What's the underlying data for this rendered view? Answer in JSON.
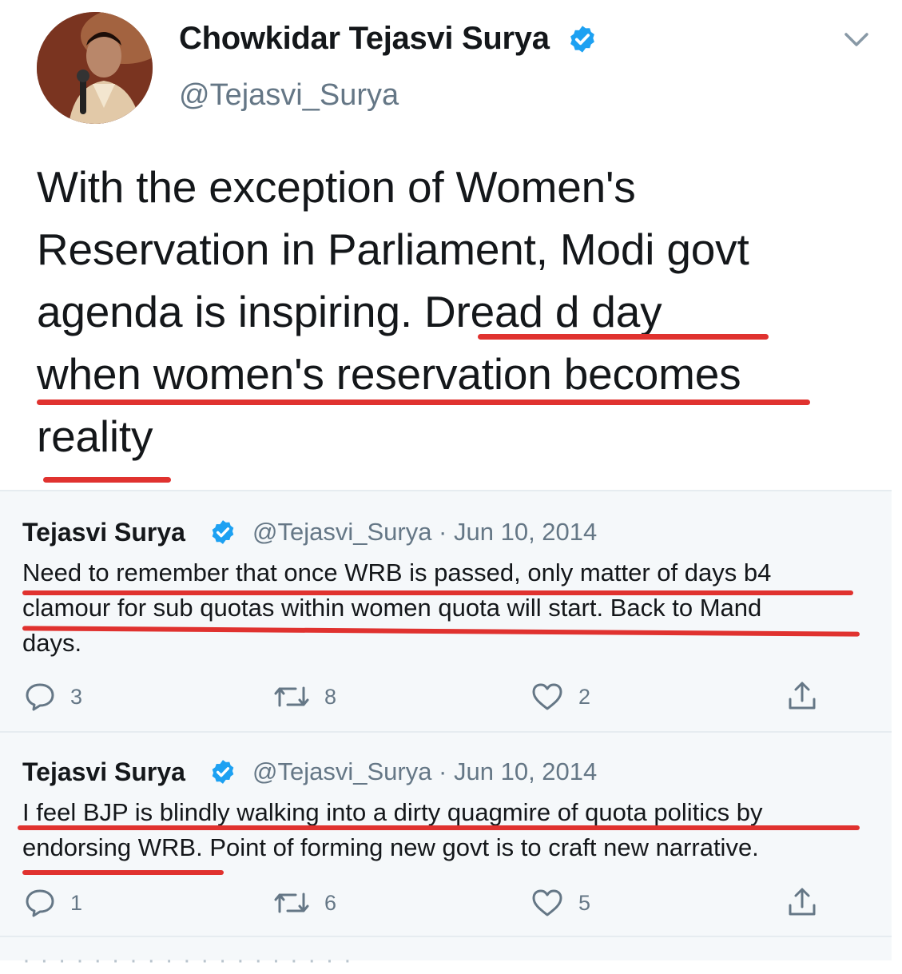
{
  "main_tweet": {
    "display_name": "Chowkidar Tejasvi Surya",
    "handle": "@Tejasvi_Surya",
    "text_lines": [
      "With the exception of Women's",
      "Reservation in Parliament, Modi govt",
      "agenda is inspiring. Dread d day",
      "when women's reservation becomes",
      "reality"
    ]
  },
  "quoted_tweets": [
    {
      "display_name": "Tejasvi Surya",
      "meta": "@Tejasvi_Surya · Jun 10, 2014",
      "text_lines": [
        "Need to remember that once WRB is passed, only matter of days b4",
        "clamour for sub quotas within women quota will start. Back to Mand",
        "days."
      ],
      "replies": "3",
      "retweets": "8",
      "likes": "2"
    },
    {
      "display_name": "Tejasvi Surya",
      "meta": "@Tejasvi_Surya · Jun 10, 2014",
      "text_lines": [
        "I feel BJP is blindly walking into a dirty quagmire of quota politics by",
        "endorsing WRB. Point of forming new govt is to craft new narrative."
      ],
      "replies": "1",
      "retweets": "6",
      "likes": "5"
    }
  ],
  "bottom_faded_text": "· · · ·   · · · ·   · · ·   · · · ·   · · · ·",
  "colors": {
    "verified_blue": "#1da1f2",
    "annotation_red": "#e0322f",
    "secondary_text": "#657786",
    "quote_background": "#f5f8fa"
  },
  "icons": [
    "chevron-down-icon",
    "verified-badge-icon",
    "reply-icon",
    "retweet-icon",
    "like-icon",
    "share-icon"
  ]
}
